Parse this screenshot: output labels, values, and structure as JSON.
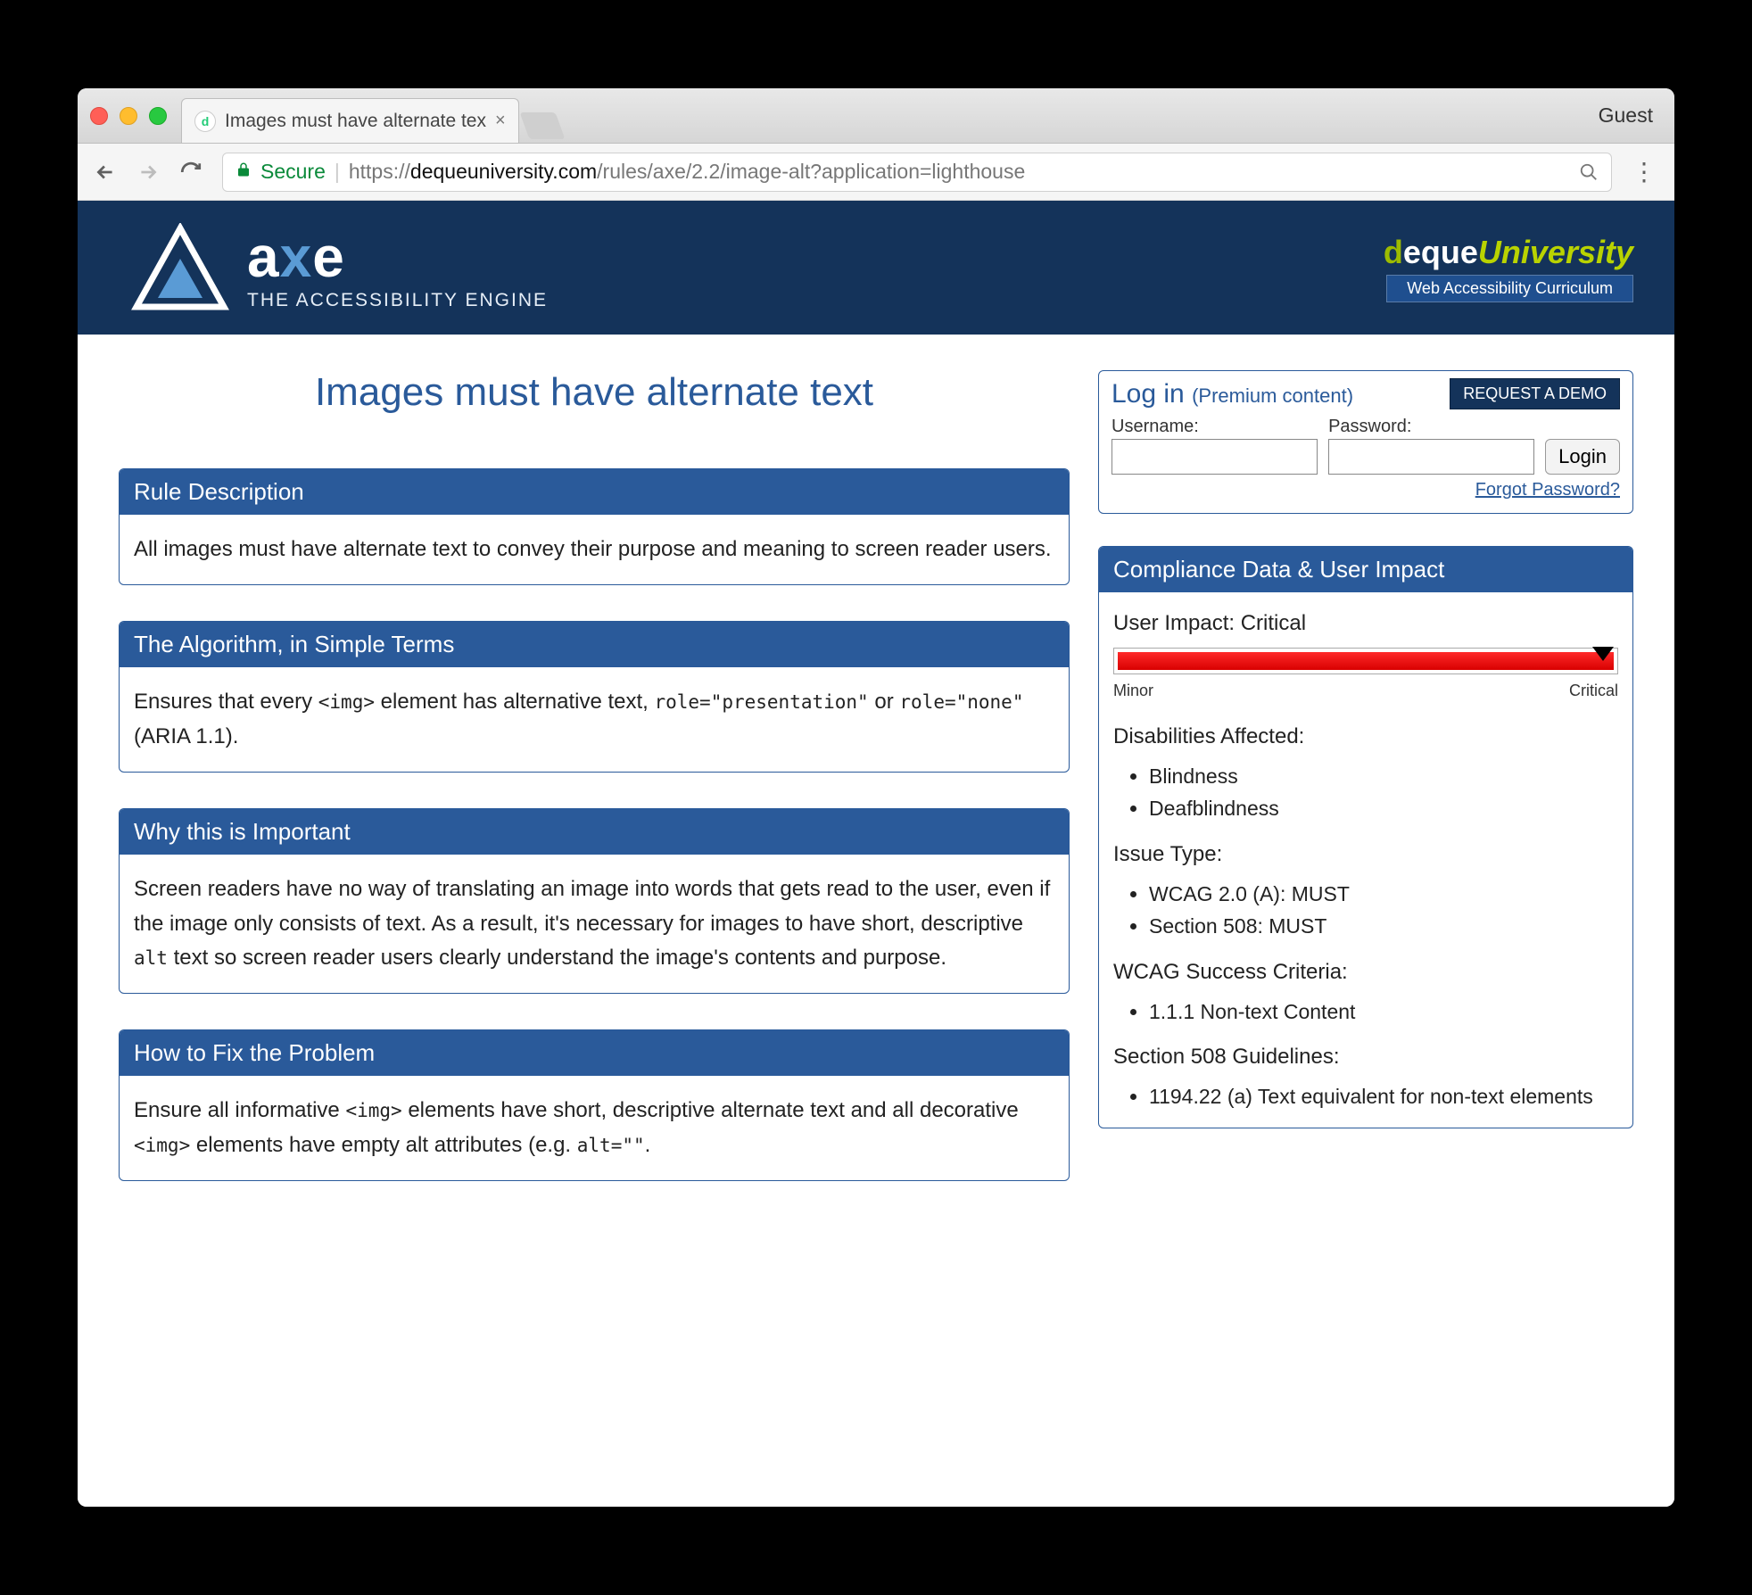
{
  "window": {
    "tab_title": "Images must have alternate tex",
    "guest_label": "Guest"
  },
  "toolbar": {
    "secure_label": "Secure",
    "url_scheme": "https://",
    "url_host": "dequeuniversity.com",
    "url_path": "/rules/axe/2.2/image-alt?application=lighthouse"
  },
  "header": {
    "brand_main": "axe",
    "brand_sub": "THE ACCESSIBILITY ENGINE",
    "du_d": "d",
    "du_eque": "eque",
    "du_uni": "University",
    "du_tag": "Web Accessibility Curriculum"
  },
  "login": {
    "title": "Log in",
    "premium": "(Premium content)",
    "demo": "REQUEST A DEMO",
    "username_label": "Username:",
    "password_label": "Password:",
    "login_btn": "Login",
    "forgot": "Forgot Password?"
  },
  "page_title": "Images must have alternate text",
  "panels": {
    "rule_h": "Rule Description",
    "rule_b": "All images must have alternate text to convey their purpose and meaning to screen reader users.",
    "algo_h": "The Algorithm, in Simple Terms",
    "algo_b1": "Ensures that every ",
    "algo_c1": "<img>",
    "algo_b2": " element has alternative text, ",
    "algo_c2": "role=\"presentation\"",
    "algo_b3": " or ",
    "algo_c3": "role=\"none\"",
    "algo_b4": " (ARIA 1.1).",
    "why_h": "Why this is Important",
    "why_b1": "Screen readers have no way of translating an image into words that gets read to the user, even if the image only consists of text. As a result, it's necessary for images to have short, descriptive ",
    "why_c1": "alt",
    "why_b2": " text so screen reader users clearly understand the image's contents and purpose.",
    "fix_h": "How to Fix the Problem",
    "fix_b1": "Ensure all informative ",
    "fix_c1": "<img>",
    "fix_b2": " elements have short, descriptive alternate text and all decorative ",
    "fix_c2": "<img>",
    "fix_b3": " elements have empty alt attributes (e.g. ",
    "fix_c3": "alt=\"\"",
    "fix_b4": "."
  },
  "compliance": {
    "h": "Compliance Data & User Impact",
    "impact_label": "User Impact:",
    "impact_value": "Critical",
    "scale_min": "Minor",
    "scale_max": "Critical",
    "dis_h": "Disabilities Affected:",
    "dis_items": [
      "Blindness",
      "Deafblindness"
    ],
    "issue_h": "Issue Type:",
    "issue_items": [
      "WCAG 2.0 (A): MUST",
      "Section 508: MUST"
    ],
    "wcag_h": "WCAG Success Criteria:",
    "wcag_items": [
      "1.1.1 Non-text Content"
    ],
    "s508_h": "Section 508 Guidelines:",
    "s508_items": [
      "1194.22 (a) Text equivalent for non-text elements"
    ]
  }
}
